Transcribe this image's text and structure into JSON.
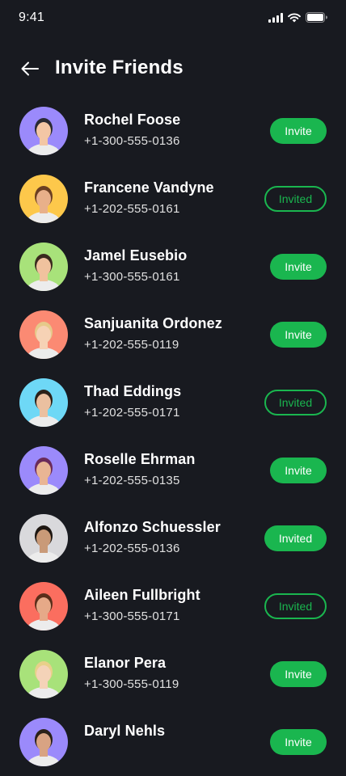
{
  "status_bar": {
    "time": "9:41"
  },
  "header": {
    "title": "Invite Friends"
  },
  "colors": {
    "background": "#181A20",
    "accent": "#1AB64F",
    "text": "#FFFFFF"
  },
  "contacts": [
    {
      "name": "Rochel Foose",
      "phone": "+1-300-555-0136",
      "action": "Invite",
      "avatar_bg": "#9B8AFB"
    },
    {
      "name": "Francene Vandyne",
      "phone": "+1-202-555-0161",
      "action": "Invited",
      "avatar_bg": "#FDC84B"
    },
    {
      "name": "Jamel Eusebio",
      "phone": "+1-300-555-0161",
      "action": "Invite",
      "avatar_bg": "#A8E27A"
    },
    {
      "name": "Sanjuanita Ordonez",
      "phone": "+1-202-555-0119",
      "action": "Invite",
      "avatar_bg": "#FB8A73"
    },
    {
      "name": "Thad Eddings",
      "phone": "+1-202-555-0171",
      "action": "Invited",
      "avatar_bg": "#6ED8F6"
    },
    {
      "name": "Roselle Ehrman",
      "phone": "+1-202-555-0135",
      "action": "Invite",
      "avatar_bg": "#9B8AFB"
    },
    {
      "name": "Alfonzo Schuessler",
      "phone": "+1-202-555-0136",
      "action": "Invited",
      "avatar_bg": "#D9D9DC"
    },
    {
      "name": "Aileen Fullbright",
      "phone": "+1-300-555-0171",
      "action": "Invited",
      "avatar_bg": "#FB6E5F"
    },
    {
      "name": "Elanor Pera",
      "phone": "+1-300-555-0119",
      "action": "Invite",
      "avatar_bg": "#A8E27A"
    },
    {
      "name": "Daryl Nehls",
      "phone": "",
      "action": "Invite",
      "avatar_bg": "#9B8AFB"
    }
  ]
}
